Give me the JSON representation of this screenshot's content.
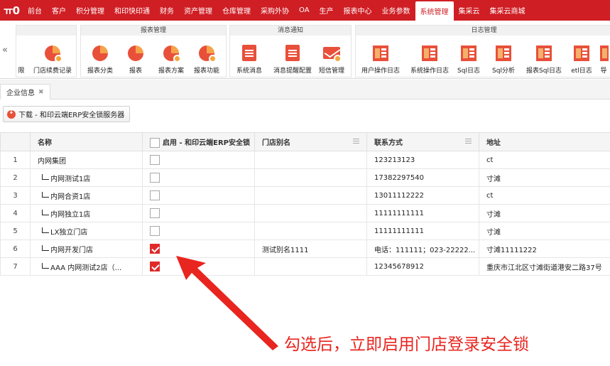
{
  "topnav": {
    "logo": "ㅠ0",
    "items": [
      "前台",
      "客户",
      "积分管理",
      "和印快印通",
      "财务",
      "资产管理",
      "仓库管理",
      "采购外协",
      "OA",
      "生产",
      "报表中心",
      "业务参数",
      "系统管理",
      "集采云",
      "集采云商城"
    ],
    "active_index": 12
  },
  "ribbon": {
    "collapse": "«",
    "groups": [
      {
        "title": "",
        "items": [
          "限",
          "门店续费记录"
        ]
      },
      {
        "title": "报表管理",
        "items": [
          "报表分类",
          "报表",
          "报表方案",
          "报表功能"
        ]
      },
      {
        "title": "消息通知",
        "items": [
          "系统消息",
          "消息提醒配置",
          "短信管理"
        ]
      },
      {
        "title": "日志管理",
        "items": [
          "用户操作日志",
          "系统操作日志",
          "Sql日志",
          "Sql分析",
          "报表Sql日志",
          "etl日志",
          "导"
        ]
      }
    ]
  },
  "tab": {
    "label": "企业信息",
    "close": "✖"
  },
  "toolbar": {
    "download_label": "下载 - 和印云端ERP安全锁服务器"
  },
  "grid": {
    "headers": [
      "名称",
      "启用 - 和印云端ERP安全锁",
      "门店别名",
      "联系方式",
      "地址"
    ],
    "rows": [
      {
        "n": "1",
        "name": "内网集团",
        "child": false,
        "enabled": false,
        "alias": "",
        "contact": "123213123",
        "address": "ct"
      },
      {
        "n": "2",
        "name": "内网测试1店",
        "child": true,
        "enabled": false,
        "alias": "",
        "contact": "17382297540",
        "address": "寸滩"
      },
      {
        "n": "3",
        "name": "内网合资1店",
        "child": true,
        "enabled": false,
        "alias": "",
        "contact": "13011112222",
        "address": "ct"
      },
      {
        "n": "4",
        "name": "内网独立1店",
        "child": true,
        "enabled": false,
        "alias": "",
        "contact": "11111111111",
        "address": "寸滩"
      },
      {
        "n": "5",
        "name": "LX独立门店",
        "child": true,
        "enabled": false,
        "alias": "",
        "contact": "11111111111",
        "address": "寸滩"
      },
      {
        "n": "6",
        "name": "内网开发门店",
        "child": true,
        "enabled": true,
        "alias": "测试别名1111",
        "contact": "电话：111111；023-22222...",
        "address": "寸滩11111222"
      },
      {
        "n": "7",
        "name": "AAA 内网测试2店（...",
        "child": true,
        "enabled": true,
        "alias": "",
        "contact": "12345678912",
        "address": "重庆市江北区寸滩街道港安二路37号"
      }
    ]
  },
  "annotation": {
    "text": "勾选后，立即启用门店登录安全锁",
    "color": "#e8251f"
  }
}
